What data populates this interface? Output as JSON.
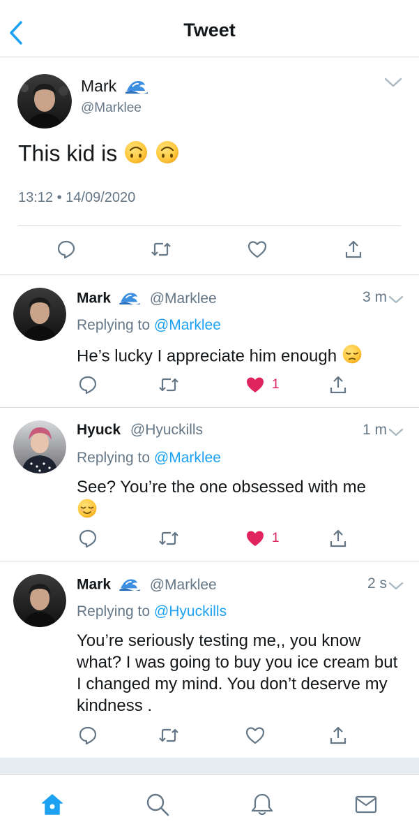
{
  "header": {
    "title": "Tweet",
    "back_icon": "chevron-left-icon"
  },
  "colors": {
    "accent": "#1da1f2",
    "text_primary": "#14171a",
    "text_secondary": "#657786",
    "like_red": "#e0245e",
    "divider": "#d8dde2"
  },
  "main_tweet": {
    "name": "Mark",
    "name_emoji": "water-wave-emoji",
    "handle": "@Marklee",
    "text": "This kid is",
    "text_emojis": [
      "upside-down-face-emoji",
      "upside-down-face-emoji"
    ],
    "timestamp": "13:12 • 14/09/2020",
    "actions": [
      "reply-icon",
      "retweet-icon",
      "like-icon",
      "share-icon"
    ]
  },
  "replies": [
    {
      "name": "Mark",
      "handle": "@Marklee",
      "time": "3 m",
      "replying_prefix": "Replying to ",
      "replying_to": "@Marklee",
      "text": "He’s lucky I appreciate him enough",
      "text_emoji": "pensive-face-emoji",
      "liked": true,
      "like_count": "1"
    },
    {
      "name": "Hyuck",
      "handle": "@Hyuckills",
      "time": "1 m",
      "replying_prefix": "Replying to ",
      "replying_to": "@Marklee",
      "text": "See? You’re the one obsessed with me",
      "text_emoji": "relieved-face-emoji",
      "liked": true,
      "like_count": "1"
    },
    {
      "name": "Mark",
      "handle": "@Marklee",
      "time": "2 s",
      "replying_prefix": "Replying to ",
      "replying_to": "@Hyuckills",
      "text": "You’re seriously testing me,, you know what? I was going to buy you ice cream but I changed my mind. You don’t deserve my kindness .",
      "liked": false,
      "like_count": ""
    }
  ],
  "tabbar": {
    "items": [
      "home-icon",
      "search-icon",
      "notifications-icon",
      "messages-icon"
    ],
    "active": "home-icon"
  }
}
